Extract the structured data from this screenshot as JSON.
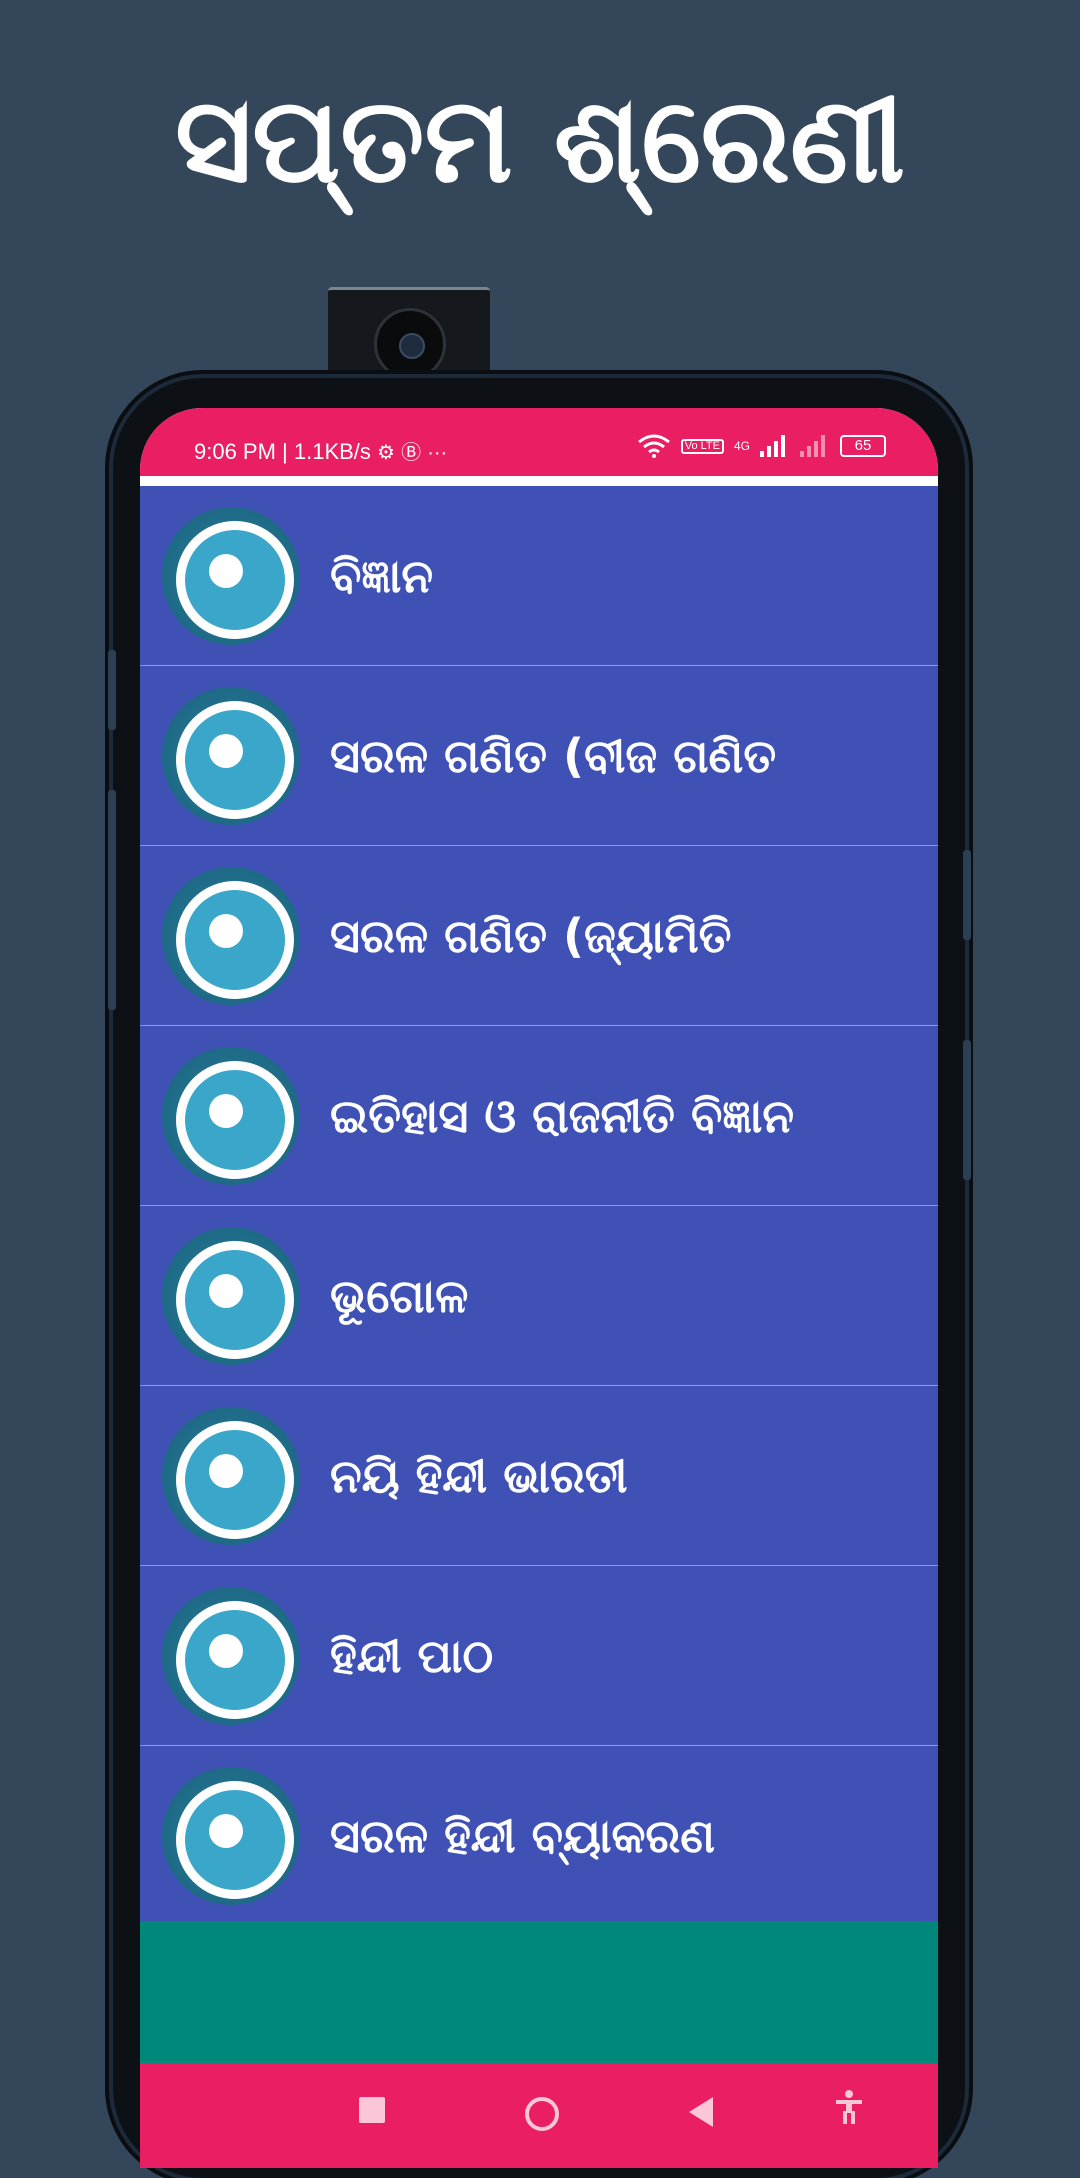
{
  "headline": "ସପ୍ତମ ଶ୍ରେଣୀ",
  "status_bar": {
    "time_speed": "9:06 PM | 1.1KB/s",
    "settings_icon": "⚙",
    "b_icon": "Ⓑ",
    "more": "···",
    "wifi_icon": "wifi-icon",
    "volte": "Vo LTE",
    "network": "4G",
    "battery": "65"
  },
  "subjects": [
    {
      "label": "ବିଜ୍ଞାନ"
    },
    {
      "label": "ସରଳ ଗଣିତ (ବୀଜ ଗଣିତ"
    },
    {
      "label": "ସରଳ ଗଣିତ (ଜ୍ୟାମିତି"
    },
    {
      "label": "ଇତିହାସ ଓ ରାଜନୀତି ବିଜ୍ଞାନ"
    },
    {
      "label": "ଭୂଗୋଳ"
    },
    {
      "label": "ନୟି ହିନ୍ଦୀ ଭାରତୀ"
    },
    {
      "label": "ହିନ୍ଦୀ ପାଠ"
    },
    {
      "label": "ସରଳ ହିନ୍ଦୀ ବ୍ୟାକରଣ"
    }
  ],
  "colors": {
    "background": "#344659",
    "accent": "#e91e63",
    "list_bg": "#3f51b5",
    "ad_area": "#00897b"
  },
  "nav": {
    "recents_icon": "square-icon",
    "home_icon": "circle-icon",
    "back_icon": "triangle-back-icon",
    "accessibility_icon": "accessibility-icon",
    "accessibility_glyph": "🚹"
  }
}
